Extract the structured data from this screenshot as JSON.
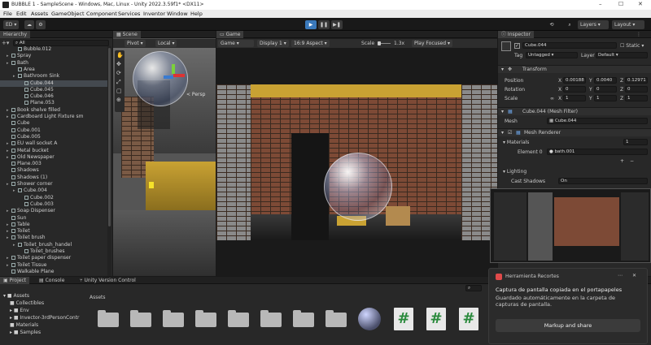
{
  "window": {
    "title": "BUBBLE 1 - SampleScene - Windows, Mac, Linux - Unity 2022.3.59f1* <DX11>",
    "controls": [
      "–",
      "☐",
      "✕"
    ]
  },
  "menu": [
    "File",
    "Edit",
    "Assets",
    "GameObject",
    "Component",
    "Services",
    "Inventor",
    "Window",
    "Help"
  ],
  "toolbar": {
    "account": "ED ▾",
    "layers": "Layers",
    "layout": "Layout"
  },
  "hierarchy": {
    "tab": "Hierarchy",
    "search_placeholder": "All",
    "items": [
      {
        "label": "Bubble.012",
        "indent": 2,
        "arrow": false
      },
      {
        "label": "Spray",
        "indent": 1,
        "arrow": true
      },
      {
        "label": "Bath",
        "indent": 1,
        "arrow": true
      },
      {
        "label": "Area",
        "indent": 2,
        "arrow": false
      },
      {
        "label": "Bathroom Sink",
        "indent": 2,
        "arrow": true
      },
      {
        "label": "Cube.044",
        "indent": 3,
        "arrow": false,
        "selected": true
      },
      {
        "label": "Cube.045",
        "indent": 3,
        "arrow": false
      },
      {
        "label": "Cube.046",
        "indent": 3,
        "arrow": false
      },
      {
        "label": "Plane.053",
        "indent": 3,
        "arrow": false
      },
      {
        "label": "Book shelve filled",
        "indent": 1,
        "arrow": true
      },
      {
        "label": "Cardboard Light Fixture sm",
        "indent": 1,
        "arrow": true
      },
      {
        "label": "Cube",
        "indent": 1,
        "arrow": false
      },
      {
        "label": "Cube.001",
        "indent": 1,
        "arrow": false
      },
      {
        "label": "Cube.005",
        "indent": 1,
        "arrow": false
      },
      {
        "label": "EU wall socket A",
        "indent": 1,
        "arrow": true
      },
      {
        "label": "Metal bucket",
        "indent": 1,
        "arrow": true
      },
      {
        "label": "Old Newspaper",
        "indent": 1,
        "arrow": true
      },
      {
        "label": "Plane.003",
        "indent": 1,
        "arrow": false
      },
      {
        "label": "Shadows",
        "indent": 1,
        "arrow": false
      },
      {
        "label": "Shadows (1)",
        "indent": 1,
        "arrow": false
      },
      {
        "label": "Shower corner",
        "indent": 1,
        "arrow": true
      },
      {
        "label": "Cube.004",
        "indent": 2,
        "arrow": true
      },
      {
        "label": "Cube.002",
        "indent": 3,
        "arrow": false
      },
      {
        "label": "Cube.003",
        "indent": 3,
        "arrow": false
      },
      {
        "label": "Soap Dispenser",
        "indent": 1,
        "arrow": true
      },
      {
        "label": "Sun",
        "indent": 1,
        "arrow": false
      },
      {
        "label": "Table",
        "indent": 1,
        "arrow": true
      },
      {
        "label": "Toilet",
        "indent": 1,
        "arrow": true
      },
      {
        "label": "Toilet brush",
        "indent": 1,
        "arrow": true
      },
      {
        "label": "Toilet_brush_handel",
        "indent": 2,
        "arrow": true
      },
      {
        "label": "Toilet_brushes",
        "indent": 3,
        "arrow": false
      },
      {
        "label": "Toilet paper dispenser",
        "indent": 1,
        "arrow": true
      },
      {
        "label": "Toilet Tissue",
        "indent": 1,
        "arrow": true
      },
      {
        "label": "Walkable Plane",
        "indent": 1,
        "arrow": false
      }
    ]
  },
  "scene": {
    "tab": "Scene",
    "pivot": "Pivot ▾",
    "local": "Local ▾",
    "persp": "< Persp"
  },
  "game": {
    "tab": "Game",
    "mode": "Game",
    "display": "Display 1",
    "aspect": "16:9 Aspect",
    "scale_label": "Scale",
    "scale_value": "1.3x",
    "play_focused": "Play Focused"
  },
  "inspector": {
    "tab": "Inspector",
    "object_name": "Cube.044",
    "static_label": "Static",
    "tag_label": "Tag",
    "tag_value": "Untagged",
    "layer_label": "Layer",
    "layer_value": "Default",
    "transform_title": "Transform",
    "position_label": "Position",
    "position": {
      "x": "0.00188",
      "y": "0.0040",
      "z": "0.12971"
    },
    "rotation_label": "Rotation",
    "rotation": {
      "x": "0",
      "y": "0",
      "z": "0"
    },
    "scale_label": "Scale",
    "scale": {
      "x": "1",
      "y": "1",
      "z": "1"
    },
    "mesh_filter_title": "Cube.044 (Mesh Filter)",
    "mesh_label": "Mesh",
    "mesh_value": "Cube.044",
    "mesh_renderer_title": "Mesh Renderer",
    "materials_label": "Materials",
    "materials_count": "1",
    "element0_label": "Element 0",
    "element0_value": "bath.001",
    "lighting_label": "Lighting",
    "cast_shadows_label": "Cast Shadows",
    "cast_shadows_value": "On"
  },
  "bottom": {
    "tabs": [
      "Project",
      "Console",
      "Unity Version Control"
    ],
    "assets_header": "Assets",
    "tree": [
      "Assets",
      "Collectibles",
      "Env",
      "Invector-3rdPersonContr",
      "Materials",
      "Samples"
    ],
    "asset_count": "22"
  },
  "toast": {
    "app": "Herramienta Recortes",
    "title": "Captura de pantalla copiada en el portapapeles",
    "body": "Guardado automáticamente en la carpeta de capturas de pantalla.",
    "button": "Markup and share"
  },
  "colors": {
    "editor_bg": "#282828",
    "selection": "#44494f",
    "play_blue": "#3a79bb",
    "brick": "#7a5a45",
    "floor_yellow": "#c9a233"
  }
}
